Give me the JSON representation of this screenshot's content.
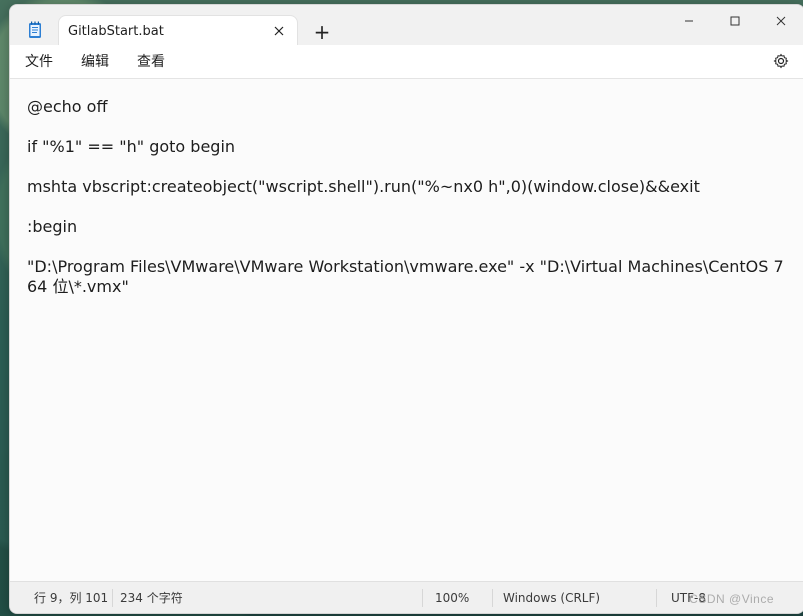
{
  "window": {
    "tab_title": "GitlabStart.bat",
    "tab_close_icon": "close-icon",
    "new_tab_symbol": "+",
    "minimize_icon": "minimize-icon",
    "maximize_icon": "maximize-icon",
    "close_icon": "close-icon"
  },
  "menu": {
    "file": "文件",
    "edit": "编辑",
    "view": "查看",
    "settings_icon": "gear-icon"
  },
  "editor": {
    "lines": [
      "@echo off",
      "",
      "if \"%1\" == \"h\" goto begin",
      "",
      "mshta vbscript:createobject(\"wscript.shell\").run(\"%~nx0 h\",0)(window.close)&&exit",
      "",
      ":begin",
      "",
      "\"D:\\Program Files\\VMware\\VMware Workstation\\vmware.exe\" -x \"D:\\Virtual Machines\\CentOS 7 64 位\\*.vmx\""
    ]
  },
  "status": {
    "position": "行 9，列 101",
    "char_count": "234 个字符",
    "zoom": "100%",
    "line_ending": "Windows (CRLF)",
    "encoding": "UTF-8"
  },
  "watermark": {
    "text": "CSDN @Vince"
  },
  "colors": {
    "window_bg": "#f3f3f3",
    "editor_bg": "#fbfbfb",
    "text": "#1d1d1d"
  }
}
